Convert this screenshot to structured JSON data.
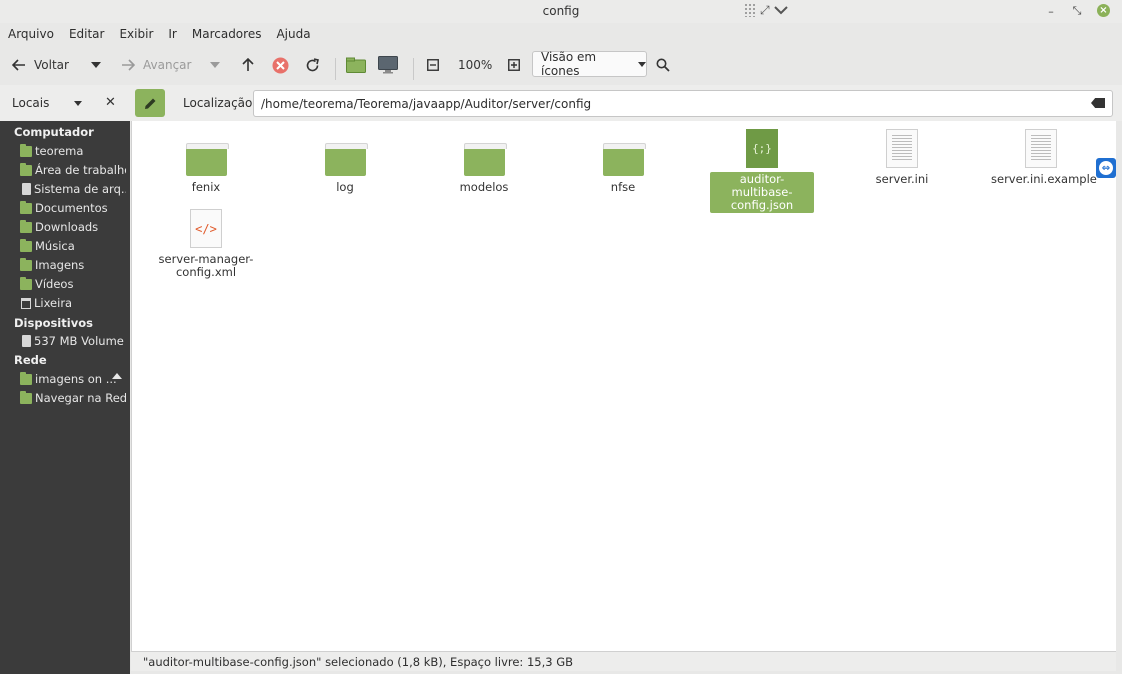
{
  "window": {
    "title": "config"
  },
  "menu": [
    "Arquivo",
    "Editar",
    "Exibir",
    "Ir",
    "Marcadores",
    "Ajuda"
  ],
  "toolbar": {
    "back_label": "Voltar",
    "forward_label": "Avançar",
    "zoom": "100%",
    "view_mode": "Visão em ícones"
  },
  "sidebar": {
    "selector_label": "Locais",
    "sections": [
      {
        "title": "Computador"
      },
      {
        "title": "Dispositivos"
      },
      {
        "title": "Rede"
      }
    ],
    "computer_items": [
      {
        "label": "teorema",
        "icon": "folder-icon"
      },
      {
        "label": "Área de trabalho",
        "icon": "folder-icon"
      },
      {
        "label": "Sistema de arq...",
        "icon": "drive-icon"
      },
      {
        "label": "Documentos",
        "icon": "folder-icon"
      },
      {
        "label": "Downloads",
        "icon": "folder-icon"
      },
      {
        "label": "Música",
        "icon": "folder-icon"
      },
      {
        "label": "Imagens",
        "icon": "folder-icon"
      },
      {
        "label": "Vídeos",
        "icon": "folder-icon"
      },
      {
        "label": "Lixeira",
        "icon": "trash-icon"
      }
    ],
    "device_items": [
      {
        "label": "537 MB Volume",
        "icon": "drive-icon"
      }
    ],
    "network_items": [
      {
        "label": "imagens on ...",
        "icon": "folder-icon"
      },
      {
        "label": "Navegar na Rede",
        "icon": "folder-icon"
      }
    ]
  },
  "location": {
    "label": "Localização:",
    "path": "/home/teorema/Teorema/javaapp/Auditor/server/config"
  },
  "files": [
    {
      "name": "fenix",
      "type": "folder"
    },
    {
      "name": "log",
      "type": "folder"
    },
    {
      "name": "modelos",
      "type": "folder"
    },
    {
      "name": "nfse",
      "type": "folder"
    },
    {
      "name": "auditor-multibase-config.json",
      "name_line1": "auditor-multibase-",
      "name_line2": "config.json",
      "type": "json",
      "selected": true,
      "glyph": "{;}"
    },
    {
      "name": "server.ini",
      "type": "text"
    },
    {
      "name": "server.ini.example",
      "type": "text"
    },
    {
      "name": "server-manager-config.xml",
      "name_line1": "server-manager-",
      "name_line2": "config.xml",
      "type": "xml",
      "glyph": "</>"
    }
  ],
  "status": "\"auditor-multibase-config.json\" selecionado (1,8 kB), Espaço livre: 15,3 GB",
  "colors": {
    "accent": "#8cb35d",
    "sidebar_bg": "#3b3b3b"
  }
}
